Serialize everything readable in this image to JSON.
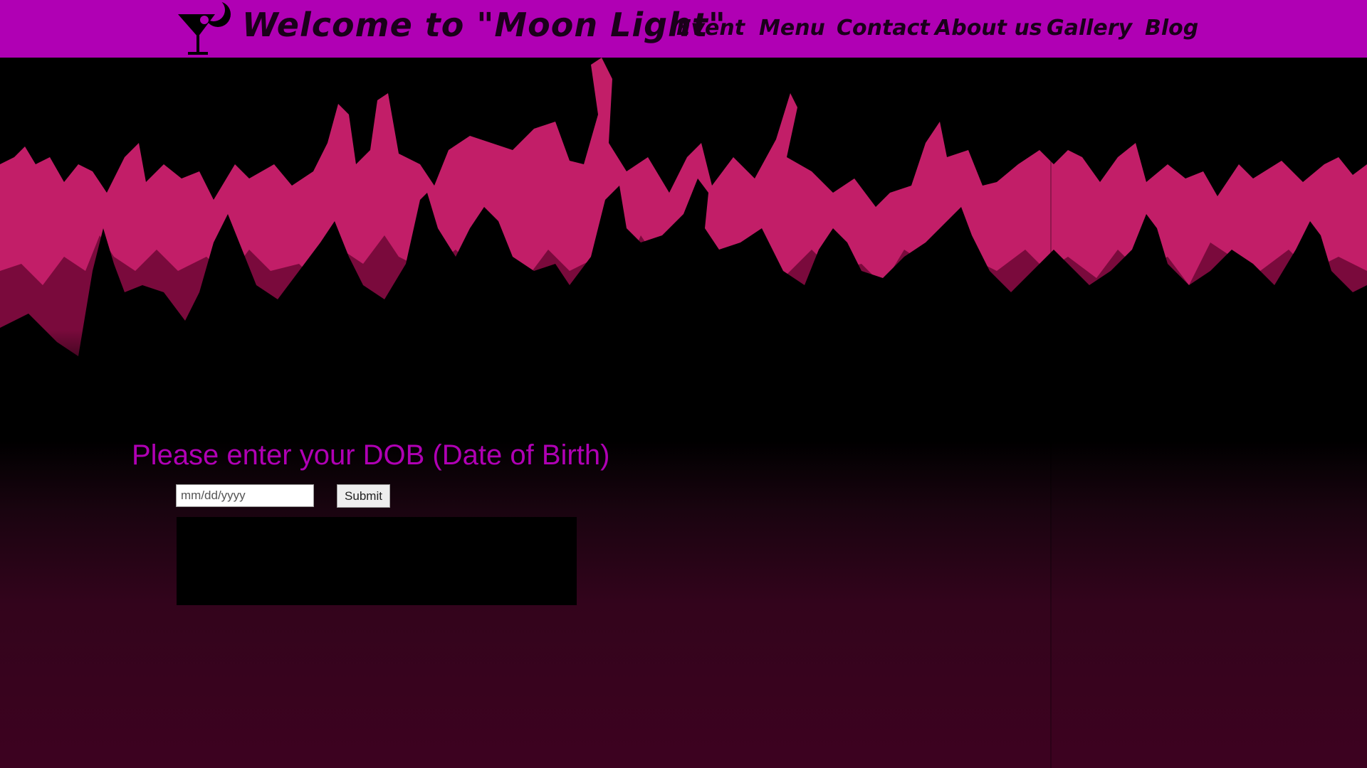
{
  "header": {
    "title": "Welcome to \"Moon Light\"",
    "logo_icon": "cocktail-moon-icon",
    "background_color": "#b000b4"
  },
  "nav": {
    "items": [
      {
        "label": "Event"
      },
      {
        "label": "Menu"
      },
      {
        "label": "Contact"
      },
      {
        "label": "About us"
      },
      {
        "label": "Gallery"
      },
      {
        "label": "Blog"
      }
    ]
  },
  "hero": {
    "description_icon": "dancing-crowd-silhouette",
    "colors": {
      "front": "#000000",
      "middle": "#7a0a3c",
      "back": "#c21e68"
    }
  },
  "form": {
    "prompt": "Please enter your DOB (Date of Birth)",
    "dob_placeholder": "mm/dd/yyyy",
    "dob_value": "",
    "submit_label": "Submit",
    "accent_color": "#b000b4"
  },
  "result": {
    "text": ""
  }
}
